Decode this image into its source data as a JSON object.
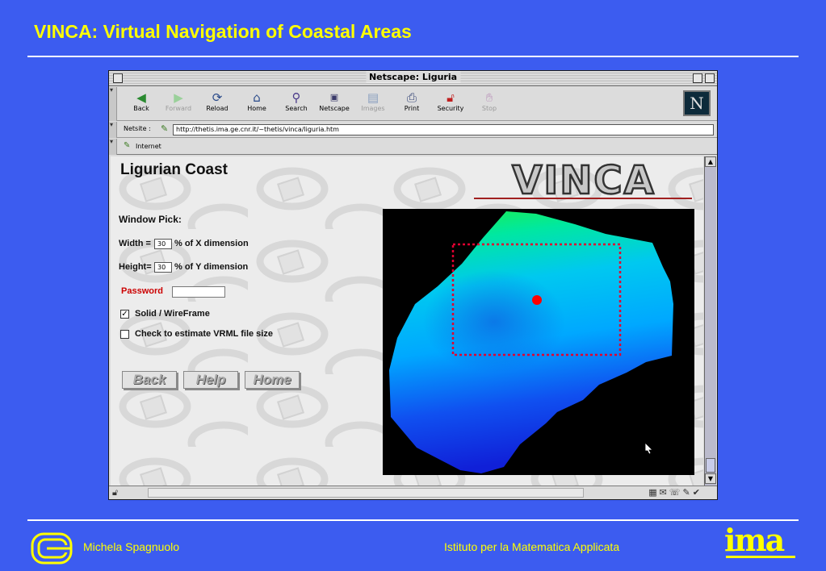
{
  "slide": {
    "title": "VINCA: Virtual Navigation of Coastal Areas",
    "footer_author": "Michela Spagnuolo",
    "footer_institute": "Istituto per la Matematica Applicata",
    "footer_logo_text": "ima"
  },
  "browser": {
    "window_title": "Netscape: Liguria",
    "toolbar": [
      {
        "label": "Back",
        "icon": "back-arrow-icon",
        "enabled": true
      },
      {
        "label": "Forward",
        "icon": "forward-arrow-icon",
        "enabled": false
      },
      {
        "label": "Reload",
        "icon": "reload-icon",
        "enabled": true
      },
      {
        "label": "Home",
        "icon": "home-icon",
        "enabled": true
      },
      {
        "label": "Search",
        "icon": "search-icon",
        "enabled": true
      },
      {
        "label": "Netscape",
        "icon": "netscape-icon",
        "enabled": true
      },
      {
        "label": "Images",
        "icon": "images-icon",
        "enabled": false
      },
      {
        "label": "Print",
        "icon": "print-icon",
        "enabled": true
      },
      {
        "label": "Security",
        "icon": "security-lock-icon",
        "enabled": true
      },
      {
        "label": "Stop",
        "icon": "stop-icon",
        "enabled": false
      }
    ],
    "logo_letter": "N",
    "location_label": "Netsite :",
    "location_url": "http://thetis.ima.ge.cnr.it/~thetis/vinca/liguria.htm",
    "personal_toolbar_item": "Internet"
  },
  "page": {
    "heading": "Ligurian Coast",
    "logo_text": "VINCA",
    "window_pick_label": "Window Pick:",
    "width_label": "Width =",
    "width_value": "30",
    "width_suffix": "% of X dimension",
    "height_label": "Height=",
    "height_value": "30",
    "height_suffix": "% of Y dimension",
    "password_label": "Password",
    "password_value": "",
    "solid_wireframe_label": "Solid / WireFrame",
    "solid_wireframe_checked": true,
    "estimate_size_label": "Check to estimate VRML file size",
    "estimate_size_checked": false,
    "buttons": {
      "back": "Back",
      "help": "Help",
      "home": "Home"
    }
  },
  "colors": {
    "slide_background": "#3c5cf0",
    "slide_text": "#ffff00",
    "terrain_low": "#1010e0",
    "terrain_mid": "#00b0ff",
    "terrain_high": "#00f040",
    "selection_rect": "#e00030",
    "pick_point": "#ff0000"
  }
}
